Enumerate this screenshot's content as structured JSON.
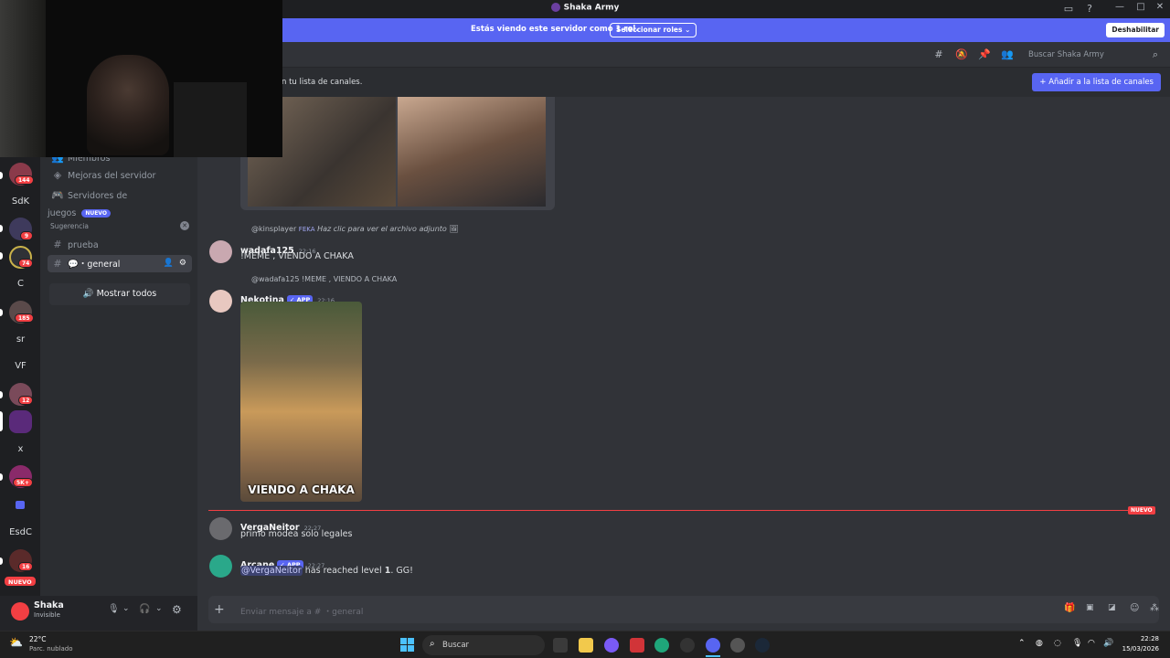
{
  "window": {
    "title": "Shaka Army",
    "controls": [
      "—",
      "□",
      "✕"
    ]
  },
  "banner": {
    "text": "Estás viendo este servidor como 1 rol.",
    "roles_button": "Seleccionar roles",
    "disable_button": "Deshabilitar"
  },
  "header": {
    "search_placeholder": "Buscar Shaka Army"
  },
  "notice": {
    "text": "n tu lista de canales.",
    "button": "Añadir a la lista de canales"
  },
  "servers": {
    "badges": [
      "144",
      "9",
      "74",
      "185",
      "12",
      "5K+",
      "16"
    ],
    "labels": [
      "SdK",
      "C",
      "sr",
      "VF",
      "x",
      "EsdC"
    ],
    "new_label": "NUEVO"
  },
  "sidebar": {
    "items": [
      {
        "label": "Miembros"
      },
      {
        "label": "Mejoras del servidor"
      },
      {
        "label": "Servidores de juegos",
        "tag": "NUEVO"
      }
    ],
    "category": "Sugerencia",
    "channels": [
      {
        "label": "prueba"
      },
      {
        "label": "・general"
      }
    ],
    "show_all": "Mostrar todos"
  },
  "user": {
    "name": "Shaka",
    "status": "Invisible"
  },
  "messages": {
    "m1": {
      "reply": "@kinsplayer",
      "reply_tag": "FEKA",
      "reply_text": "Haz clic para ver el archivo adjunto",
      "user": "wadafa125",
      "time": "22:16",
      "text": "!MEME , VIENDO A CHAKA"
    },
    "m2": {
      "reply": "@wadafa125 !MEME , VIENDO A CHAKA",
      "user": "Nekotina",
      "tag": "✓ APP",
      "time": "22:16",
      "image_caption": "VIENDO A CHAKA"
    },
    "divider": "NUEVO",
    "m3": {
      "user": "VergaNeitor",
      "time": "22:27",
      "text": "primo modea solo legales"
    },
    "m4": {
      "user": "Arcane",
      "tag": "✓ APP",
      "time": "22:27",
      "mention": "@VergaNeitor",
      "text_mid": " has reached level ",
      "level": "1",
      "text_end": ". GG!"
    }
  },
  "composer": {
    "placeholder": "Enviar mensaje a #  ・general"
  },
  "taskbar": {
    "weather_temp": "22°C",
    "weather_desc": "Parc. nublado",
    "search": "Buscar",
    "time": "22:28",
    "date": "15/03/2026"
  },
  "colors": {
    "accent": "#5865f2",
    "danger": "#f23f43",
    "bg_chat": "#313338",
    "bg_sidebar": "#2b2d31",
    "bg_servers": "#1e1f22"
  }
}
